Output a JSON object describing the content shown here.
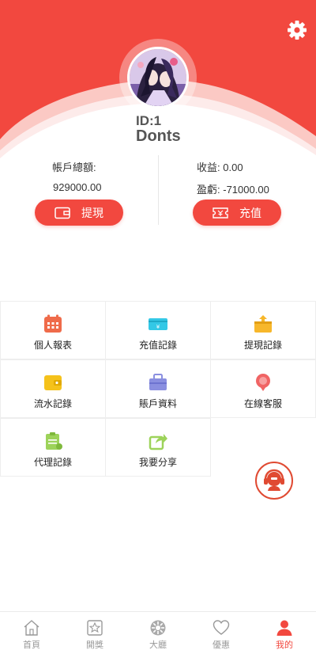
{
  "profile": {
    "id_text": "ID:1",
    "username": "Donts"
  },
  "balance": {
    "total_label": "帳戶總額:",
    "total_value": "929000.00",
    "income_label": "收益:",
    "income_value": "0.00",
    "profit_label": "盈虧:",
    "profit_value": "-71000.00",
    "withdraw_label": "提現",
    "deposit_label": "充值"
  },
  "menu": [
    {
      "label": "個人報表",
      "icon": "calendar-icon",
      "color": "#ef6b4a"
    },
    {
      "label": "充值記錄",
      "icon": "card-icon",
      "color": "#33c8e6"
    },
    {
      "label": "提現記錄",
      "icon": "gift-box-icon",
      "color": "#f7b72b"
    },
    {
      "label": "流水記錄",
      "icon": "wallet-icon",
      "color": "#f5c21b"
    },
    {
      "label": "賬戶資料",
      "icon": "briefcase-icon",
      "color": "#8a8fe0"
    },
    {
      "label": "在線客服",
      "icon": "chat-icon",
      "color": "#f06464"
    },
    {
      "label": "代理記錄",
      "icon": "clipboard-icon",
      "color": "#9dd35a"
    },
    {
      "label": "我要分享",
      "icon": "share-icon",
      "color": "#9dd35a"
    }
  ],
  "nav": [
    {
      "label": "首頁",
      "icon": "home-icon",
      "active": false
    },
    {
      "label": "開獎",
      "icon": "star-badge-icon",
      "active": false
    },
    {
      "label": "大廳",
      "icon": "lobby-icon",
      "active": false
    },
    {
      "label": "優惠",
      "icon": "heart-icon",
      "active": false
    },
    {
      "label": "我的",
      "icon": "user-icon",
      "active": true
    }
  ],
  "colors": {
    "brand": "#f2483f",
    "nav_inactive": "#999999"
  }
}
